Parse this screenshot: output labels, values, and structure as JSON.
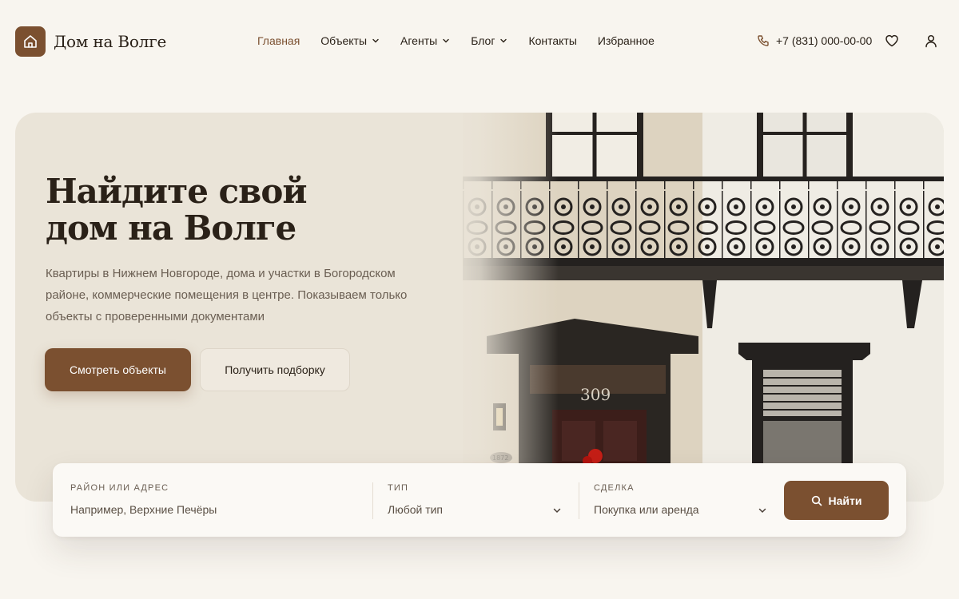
{
  "brand": {
    "name": "Дом на Волге",
    "accent": "#7b5030",
    "background": "#f8f5ef"
  },
  "nav": {
    "items": [
      {
        "label": "Главная",
        "active": true,
        "dropdown": false
      },
      {
        "label": "Объекты",
        "active": false,
        "dropdown": true
      },
      {
        "label": "Агенты",
        "active": false,
        "dropdown": true
      },
      {
        "label": "Блог",
        "active": false,
        "dropdown": true
      },
      {
        "label": "Контакты",
        "active": false,
        "dropdown": false
      },
      {
        "label": "Избранное",
        "active": false,
        "dropdown": false
      }
    ]
  },
  "header": {
    "phone": "+7 (831) 000-00-00",
    "icons": [
      "phone-icon",
      "heart-icon",
      "user-icon",
      "home-icon"
    ]
  },
  "hero": {
    "title_line1": "Найдите свой",
    "title_line2": "дом на Волге",
    "subtitle": "Квартиры в Нижнем Новгороде, дома и участки в Богородском районе, коммерческие помещения в центре. Показываем только объекты с проверенными документами",
    "primary_button": "Смотреть объекты",
    "secondary_button": "Получить подборку",
    "house_number": "309",
    "plaque_number": "1872"
  },
  "search": {
    "location": {
      "label": "Район или адрес",
      "placeholder": "Например, Верхние Печёры"
    },
    "type": {
      "label": "Тип",
      "value": "Любой тип"
    },
    "deal": {
      "label": "Сделка",
      "value": "Покупка или аренда"
    },
    "submit": "Найти"
  }
}
